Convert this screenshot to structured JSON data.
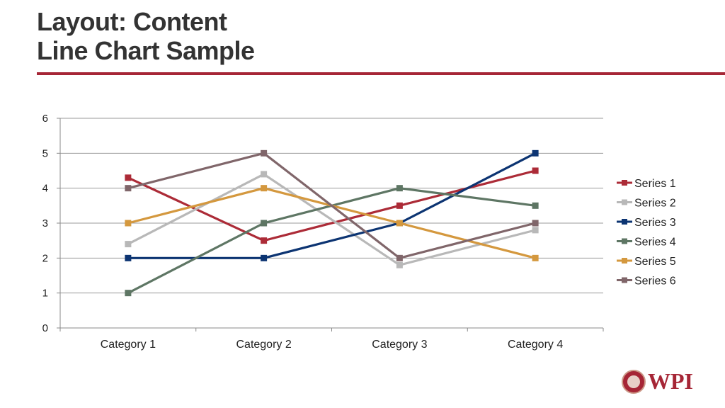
{
  "header": {
    "line1": "Layout: Content",
    "line2": "Line Chart Sample"
  },
  "logo": {
    "text": "WPI"
  },
  "chart_data": {
    "type": "line",
    "categories": [
      "Category 1",
      "Category 2",
      "Category 3",
      "Category 4"
    ],
    "ylim": [
      0,
      6
    ],
    "yticks": [
      "0",
      "1",
      "2",
      "3",
      "4",
      "5",
      "6"
    ],
    "grid": true,
    "legend": "right",
    "series": [
      {
        "name": "Series 1",
        "values": [
          4.3,
          2.5,
          3.5,
          4.5
        ],
        "color": "#AC2B37"
      },
      {
        "name": "Series 2",
        "values": [
          2.4,
          4.4,
          1.8,
          2.8
        ],
        "color": "#B8B8B8"
      },
      {
        "name": "Series 3",
        "values": [
          2,
          2,
          3,
          5
        ],
        "color": "#0C3472"
      },
      {
        "name": "Series 4",
        "values": [
          1,
          3,
          4,
          3.5
        ],
        "color": "#5E7664"
      },
      {
        "name": "Series 5",
        "values": [
          3,
          4,
          3,
          2
        ],
        "color": "#D4983E"
      },
      {
        "name": "Series 6",
        "values": [
          4,
          5,
          2,
          3
        ],
        "color": "#80666A"
      }
    ]
  }
}
